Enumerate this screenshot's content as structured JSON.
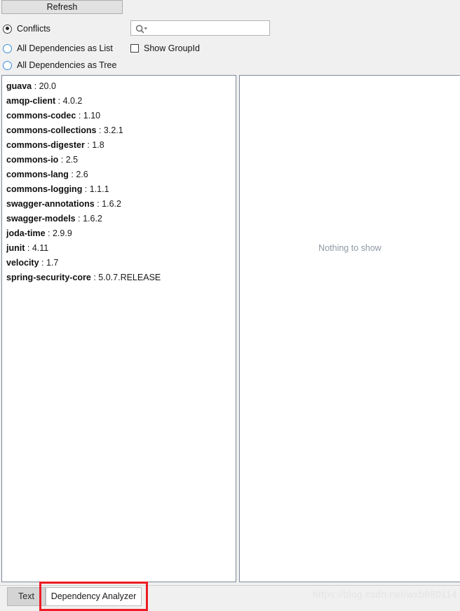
{
  "toolbar": {
    "refresh_label": "Refresh",
    "view_mode_options": [
      {
        "label": "Conflicts",
        "selected": true
      },
      {
        "label": "All Dependencies as List",
        "selected": false
      },
      {
        "label": "All Dependencies as Tree",
        "selected": false
      }
    ],
    "search": {
      "value": "",
      "placeholder": "",
      "icon": "search-icon"
    },
    "show_group_id": {
      "label": "Show GroupId",
      "checked": false
    }
  },
  "left_panel": {
    "dependencies": [
      {
        "name": "guava",
        "separator": " : ",
        "version": "20.0"
      },
      {
        "name": "amqp-client",
        "separator": " : ",
        "version": "4.0.2"
      },
      {
        "name": "commons-codec",
        "separator": " : ",
        "version": "1.10"
      },
      {
        "name": "commons-collections",
        "separator": " : ",
        "version": "3.2.1"
      },
      {
        "name": "commons-digester",
        "separator": " : ",
        "version": "1.8"
      },
      {
        "name": "commons-io",
        "separator": " : ",
        "version": "2.5"
      },
      {
        "name": "commons-lang",
        "separator": " : ",
        "version": "2.6"
      },
      {
        "name": "commons-logging",
        "separator": " : ",
        "version": "1.1.1"
      },
      {
        "name": "swagger-annotations",
        "separator": " : ",
        "version": "1.6.2"
      },
      {
        "name": "swagger-models",
        "separator": " : ",
        "version": "1.6.2"
      },
      {
        "name": "joda-time",
        "separator": " : ",
        "version": "2.9.9"
      },
      {
        "name": "junit",
        "separator": " : ",
        "version": "4.11"
      },
      {
        "name": "velocity",
        "separator": " : ",
        "version": "1.7"
      },
      {
        "name": "spring-security-core",
        "separator": " : ",
        "version": "5.0.7.RELEASE"
      }
    ]
  },
  "right_panel": {
    "empty_message": "Nothing to show"
  },
  "tabs": [
    {
      "label": "Text",
      "active": false
    },
    {
      "label": "Dependency Analyzer",
      "active": true
    }
  ],
  "highlight": {
    "color": "#ee1c25",
    "target": "Dependency Analyzer"
  },
  "watermark": {
    "text": "https://blog.csdn.net/wxb880114",
    "color": "#e4e4e4"
  },
  "colors": {
    "toolbar_background": "#f0f0f0",
    "panel_background": "#ffffff",
    "panel_border": "#7d8a9c",
    "radio_unselected": "#3a8cd8",
    "empty_text": "#8f97a5"
  }
}
